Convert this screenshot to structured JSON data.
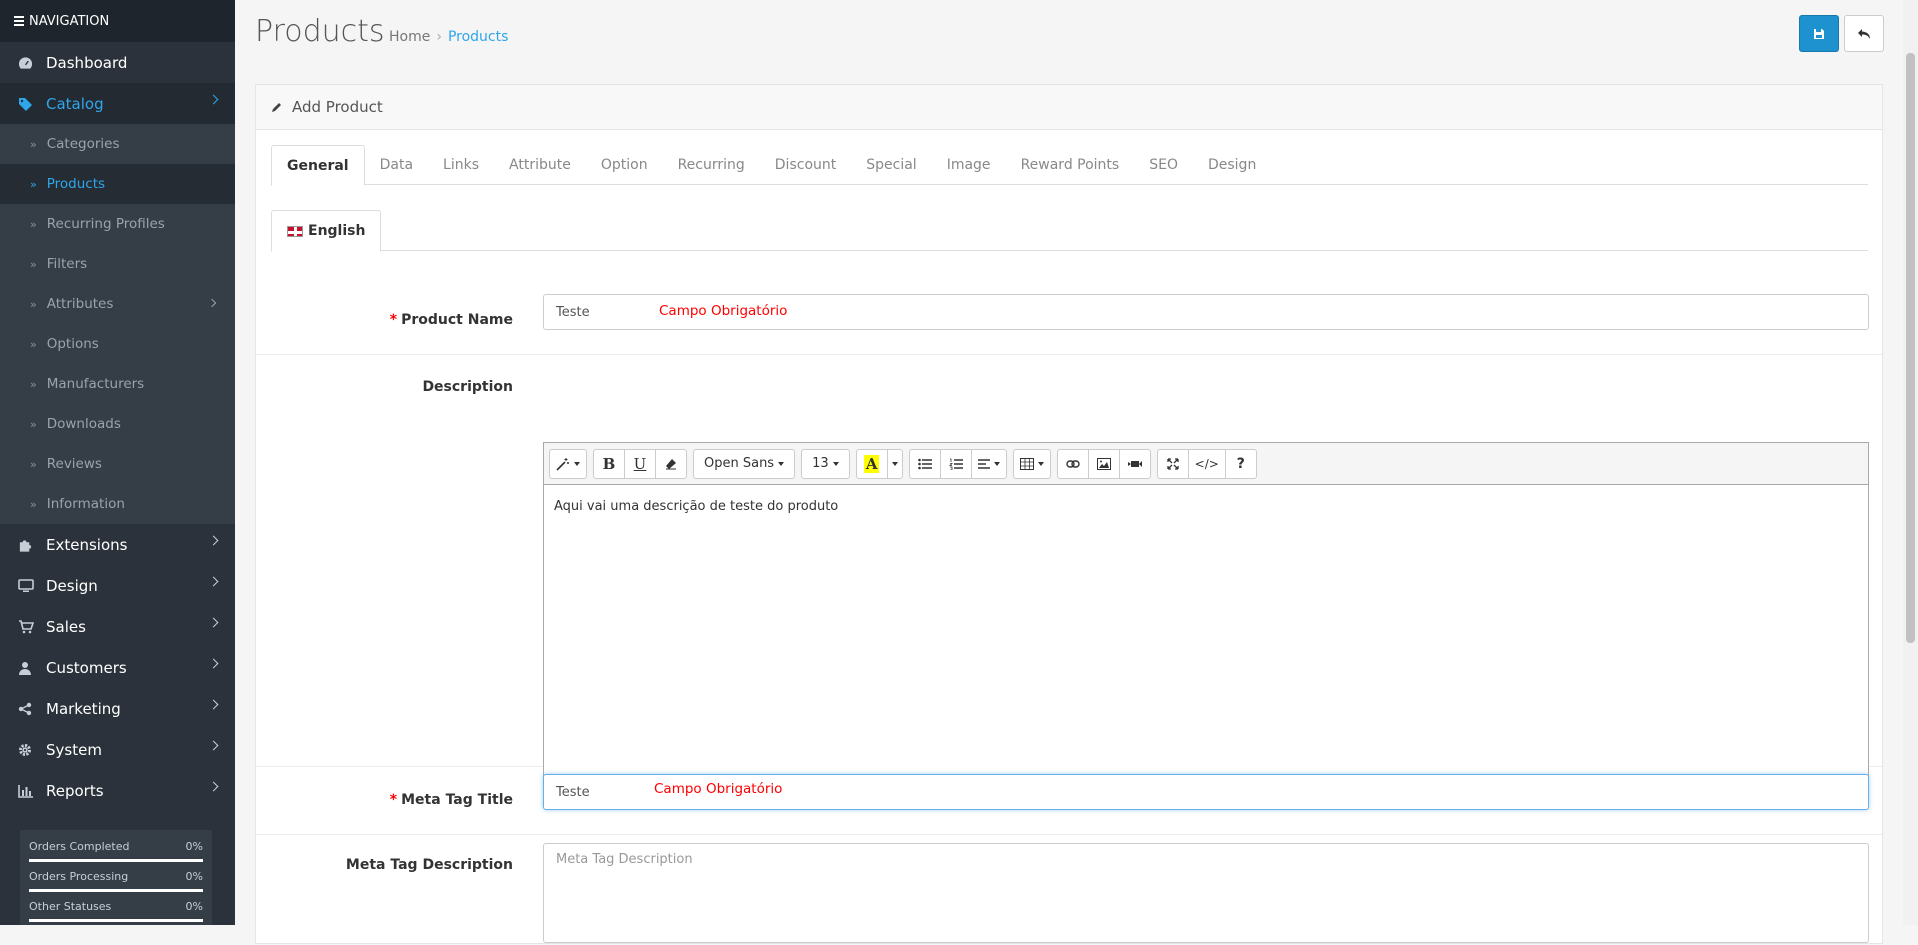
{
  "sidebar": {
    "header": "NAVIGATION",
    "items": [
      {
        "label": "Dashboard",
        "icon": "dashboard-icon"
      },
      {
        "label": "Catalog",
        "icon": "tags-icon"
      },
      {
        "label": "Extensions",
        "icon": "puzzle-icon"
      },
      {
        "label": "Design",
        "icon": "desktop-icon"
      },
      {
        "label": "Sales",
        "icon": "cart-icon"
      },
      {
        "label": "Customers",
        "icon": "user-icon"
      },
      {
        "label": "Marketing",
        "icon": "share-icon"
      },
      {
        "label": "System",
        "icon": "gear-icon"
      },
      {
        "label": "Reports",
        "icon": "bar-chart-icon"
      }
    ],
    "catalog_sub": [
      "Categories",
      "Products",
      "Recurring Profiles",
      "Filters",
      "Attributes",
      "Options",
      "Manufacturers",
      "Downloads",
      "Reviews",
      "Information"
    ],
    "stats": [
      {
        "label": "Orders Completed",
        "value": "0%"
      },
      {
        "label": "Orders Processing",
        "value": "0%"
      },
      {
        "label": "Other Statuses",
        "value": "0%"
      }
    ],
    "accent_color": "#2fa6ea"
  },
  "header": {
    "title": "Products",
    "breadcrumb": {
      "home": "Home",
      "sep": "›",
      "current": "Products"
    }
  },
  "panel": {
    "title": "Add Product",
    "tabs": [
      "General",
      "Data",
      "Links",
      "Attribute",
      "Option",
      "Recurring",
      "Discount",
      "Special",
      "Image",
      "Reward Points",
      "SEO",
      "Design"
    ],
    "language": "English"
  },
  "form": {
    "product_name": {
      "label": "Product Name",
      "value": "Teste",
      "error": "Campo Obrigatório"
    },
    "description": {
      "label": "Description",
      "content": "Aqui vai uma descrição de teste do produto"
    },
    "meta_title": {
      "label": "Meta Tag Title",
      "value": "Teste",
      "error": "Campo Obrigatório"
    },
    "meta_description": {
      "label": "Meta Tag Description",
      "placeholder": "Meta Tag Description"
    },
    "required_mark": "*"
  },
  "editor": {
    "font_name": "Open Sans",
    "font_size": "13",
    "bold": "B",
    "underline": "U",
    "code": "</>",
    "help": "?",
    "highlight": "A"
  }
}
